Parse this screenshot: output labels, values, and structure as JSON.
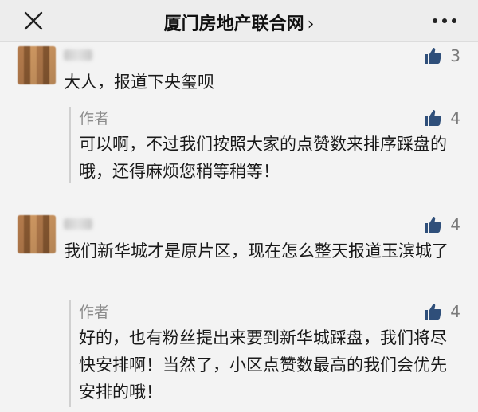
{
  "header": {
    "title": "厦门房地产联合网",
    "chevron": "›",
    "close_icon": "close-icon",
    "more_icon": "more-dots-icon"
  },
  "comments": [
    {
      "text": "大人，报道下央玺呗",
      "likes": "3",
      "reply": {
        "author": "作者",
        "likes": "4",
        "text": "可以啊，不过我们按照大家的点赞数来排序踩盘的哦，还得麻烦您稍等稍等！"
      }
    },
    {
      "text": "我们新华城才是原片区，现在怎么整天报道玉滨城了",
      "likes": "4",
      "reply": {
        "author": "作者",
        "likes": "4",
        "text": "好的，也有粉丝提出来要到新华城踩盘，我们将尽快安排啊！当然了，小区点赞数最高的我们会优先安排的哦！"
      }
    }
  ],
  "colors": {
    "like_blue": "#2f4f7a",
    "muted_text": "#8c8c8c"
  }
}
